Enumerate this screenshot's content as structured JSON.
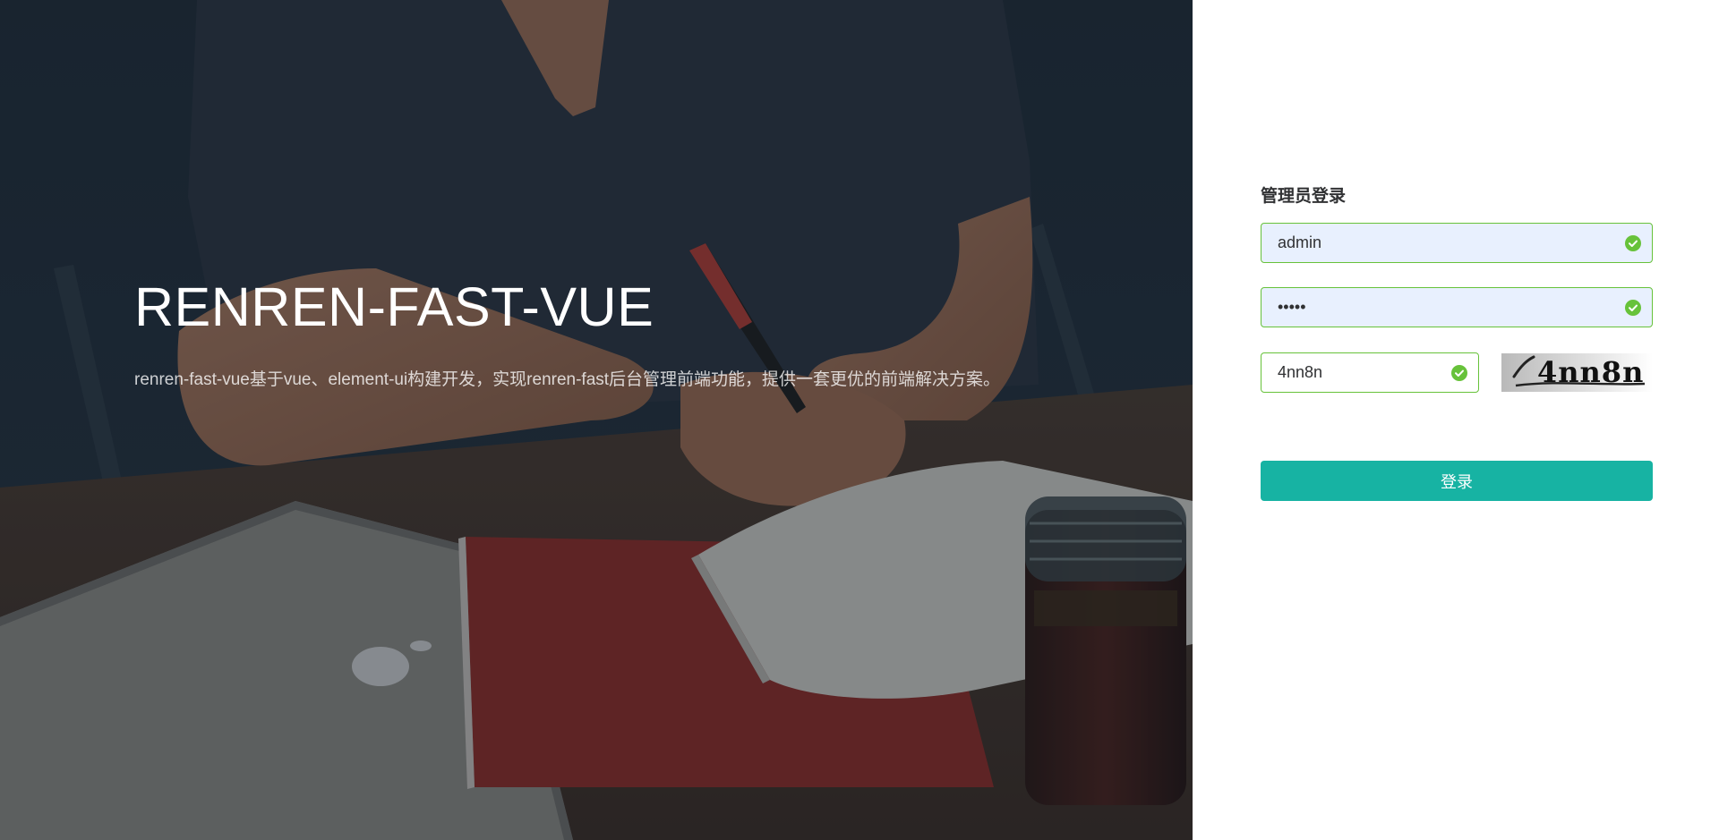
{
  "hero": {
    "title": "RENREN-FAST-VUE",
    "description": "renren-fast-vue基于vue、element-ui构建开发，实现renren-fast后台管理前端功能，提供一套更优的前端解决方案。"
  },
  "login": {
    "title": "管理员登录",
    "username": {
      "value": "admin",
      "valid": true
    },
    "password": {
      "value": "admin",
      "valid": true
    },
    "captcha": {
      "value": "4nn8n",
      "valid": true
    },
    "captcha_image_text": "4nn8n",
    "submit_label": "登录"
  },
  "colors": {
    "accent": "#17b3a3",
    "success": "#67c23a",
    "autofill_bg": "#e8f0fe"
  },
  "icons": {
    "field_status": "check-circle-icon"
  }
}
